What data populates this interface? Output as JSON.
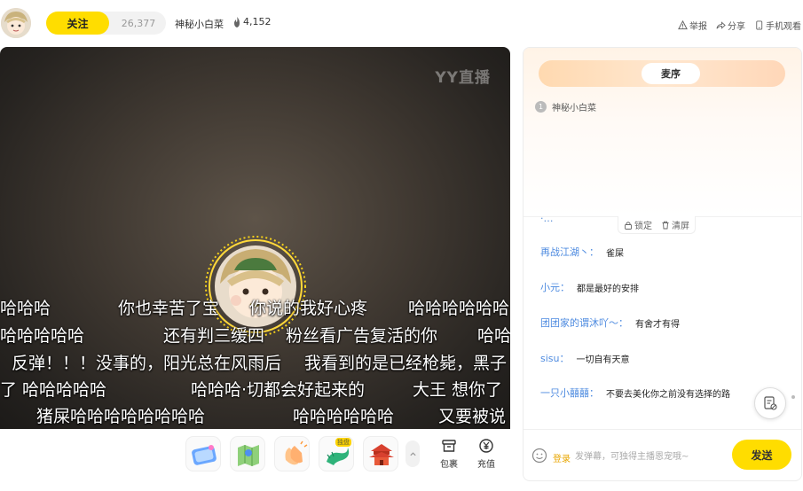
{
  "header": {
    "follow_label": "关注",
    "follower_count": "26,377",
    "host_name": "神秘小白菜",
    "heat_value": "4,152",
    "report_label": "举报",
    "share_label": "分享",
    "mobile_label": "手机观看"
  },
  "video": {
    "watermark": "YY直播",
    "danmaku_rows": [
      [
        "哈哈哈",
        "你也幸苦了宝",
        "你说的我好心疼",
        "哈哈哈哈哈哈"
      ],
      [
        "哈哈哈哈哈",
        "还有判三缓四",
        "粉丝看广告复活的你",
        "哈哈"
      ],
      [
        "反弹！！！没事的，阳光总在风雨后",
        "我看到的是已经枪毙，黑子"
      ],
      [
        "了",
        "哈哈哈哈哈",
        "哈哈哈·切都会好起来的",
        "大王 想你了"
      ],
      [
        "猪屎哈哈哈哈哈哈哈哈",
        "哈哈哈哈哈哈",
        "又要被说"
      ]
    ]
  },
  "gift_bar": {
    "new_badge": "独盘",
    "more_icon": "chevron-up-icon",
    "package_label": "包裹",
    "recharge_label": "充值"
  },
  "panel": {
    "active_tab": "麦序",
    "mic_queue": [
      {
        "rank": "1",
        "name": "神秘小白菜"
      }
    ],
    "lock_label": "锁定",
    "clear_label": "清屏",
    "chat_cut": "·…",
    "chat": [
      {
        "name": "再战江湖丶：",
        "text": "雀屎"
      },
      {
        "name": "小元：",
        "text": "都是最好的安排"
      },
      {
        "name": "团团家的谓沐吖～：",
        "text": "有舍才有得"
      },
      {
        "name": "sisu：",
        "text": "一切自有天意"
      },
      {
        "name": "一只小囍囍：",
        "text": "不要去美化你之前没有选择的路"
      }
    ],
    "login_label": "登录",
    "input_placeholder": "发弹幕，可独得主播恩宠哦~",
    "send_label": "发送"
  },
  "colors": {
    "accent_yellow": "#ffdd00",
    "chat_name_blue": "#4e8be0"
  }
}
